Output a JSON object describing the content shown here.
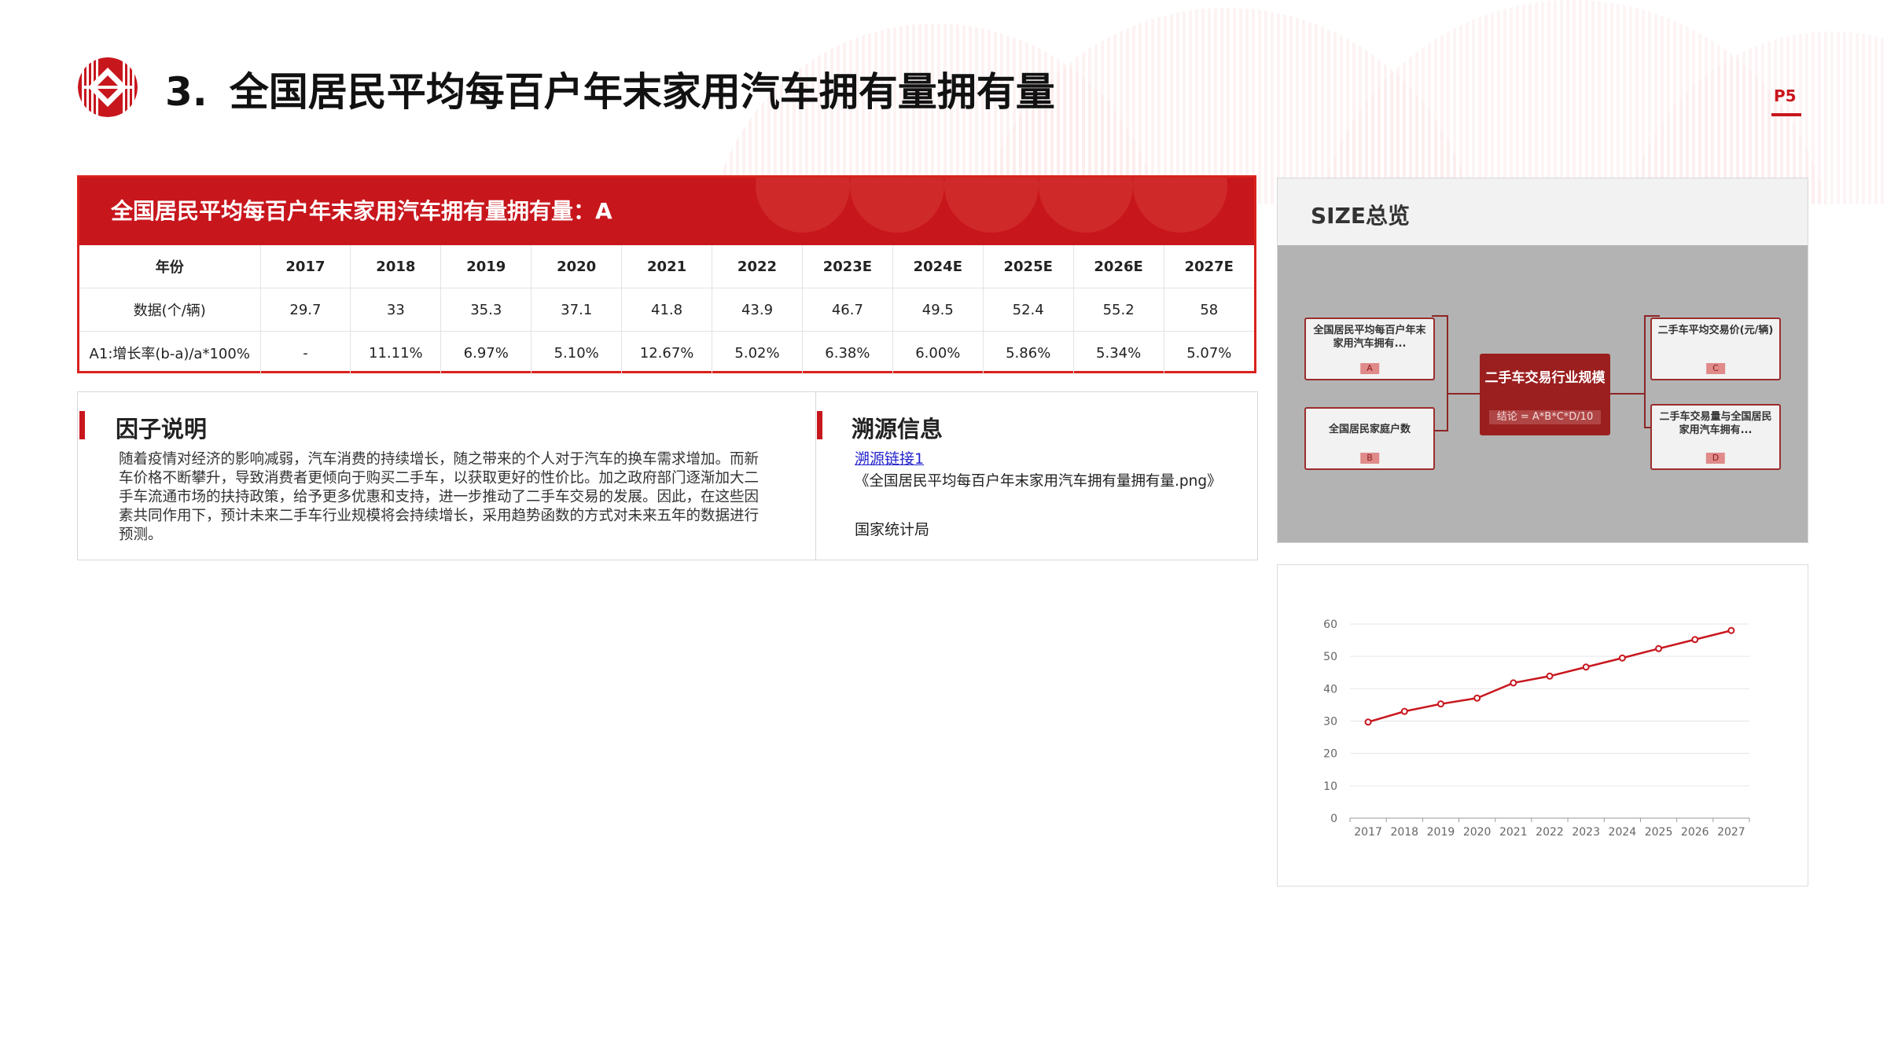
{
  "header": {
    "section_number": "3.",
    "title": "全国居民平均每百户年末家用汽车拥有量拥有量",
    "page_number": "P5"
  },
  "colors": {
    "brand_red": "#c8161d",
    "dark_red": "#9b1f1f",
    "link_blue": "#2222cc"
  },
  "data_table": {
    "title": "全国居民平均每百户年末家用汽车拥有量拥有量：A",
    "header": [
      "年份",
      "2017",
      "2018",
      "2019",
      "2020",
      "2021",
      "2022",
      "2023E",
      "2024E",
      "2025E",
      "2026E",
      "2027E"
    ],
    "rows": [
      [
        "数据(个/辆)",
        "29.7",
        "33",
        "35.3",
        "37.1",
        "41.8",
        "43.9",
        "46.7",
        "49.5",
        "52.4",
        "55.2",
        "58"
      ],
      [
        "A1:增长率(b-a)/a*100%",
        "-",
        "11.11%",
        "6.97%",
        "5.10%",
        "12.67%",
        "5.02%",
        "6.38%",
        "6.00%",
        "5.86%",
        "5.34%",
        "5.07%"
      ]
    ]
  },
  "factor": {
    "title": "因子说明",
    "text": "随着疫情对经济的影响减弱，汽车消费的持续增长，随之带来的个人对于汽车的换车需求增加。而新车价格不断攀升，导致消费者更倾向于购买二手车，以获取更好的性价比。加之政府部门逐渐加大二手车流通市场的扶持政策，给予更多优惠和支持，进一步推动了二手车交易的发展。因此，在这些因素共同作用下，预计未来二手车行业规模将会持续增长，采用趋势函数的方式对未来五年的数据进行预测。"
  },
  "source": {
    "title": "溯源信息",
    "link_text": "溯源链接1",
    "file_text": "《全国居民平均每百户年末家用汽车拥有量拥有量.png》",
    "org": "国家统计局"
  },
  "size_overview": {
    "title": "SIZE总览",
    "nodes": {
      "a": {
        "label": "全国居民平均每百户年末家用汽车拥有...",
        "tag": "A"
      },
      "b": {
        "label": "全国居民家庭户数",
        "tag": "B"
      },
      "c": {
        "label": "二手车平均交易价(元/辆)",
        "tag": "C"
      },
      "d": {
        "label": "二手车交易量与全国居民家用汽车拥有...",
        "tag": "D"
      },
      "center": {
        "label": "二手车交易行业规模",
        "formula": "结论 = A*B*C*D/10"
      }
    }
  },
  "chart_data": {
    "type": "line",
    "title": "",
    "xlabel": "",
    "ylabel": "",
    "x": [
      "2017",
      "2018",
      "2019",
      "2020",
      "2021",
      "2022",
      "2023",
      "2024",
      "2025",
      "2026",
      "2027"
    ],
    "series": [
      {
        "values": [
          29.7,
          33,
          35.3,
          37.1,
          41.8,
          43.9,
          46.7,
          49.5,
          52.4,
          55.2,
          58
        ]
      }
    ],
    "ylim": [
      0,
      60
    ],
    "yticks": [
      0,
      10,
      20,
      30,
      40,
      50,
      60
    ],
    "grid": true,
    "line_color": "#c8161d"
  }
}
